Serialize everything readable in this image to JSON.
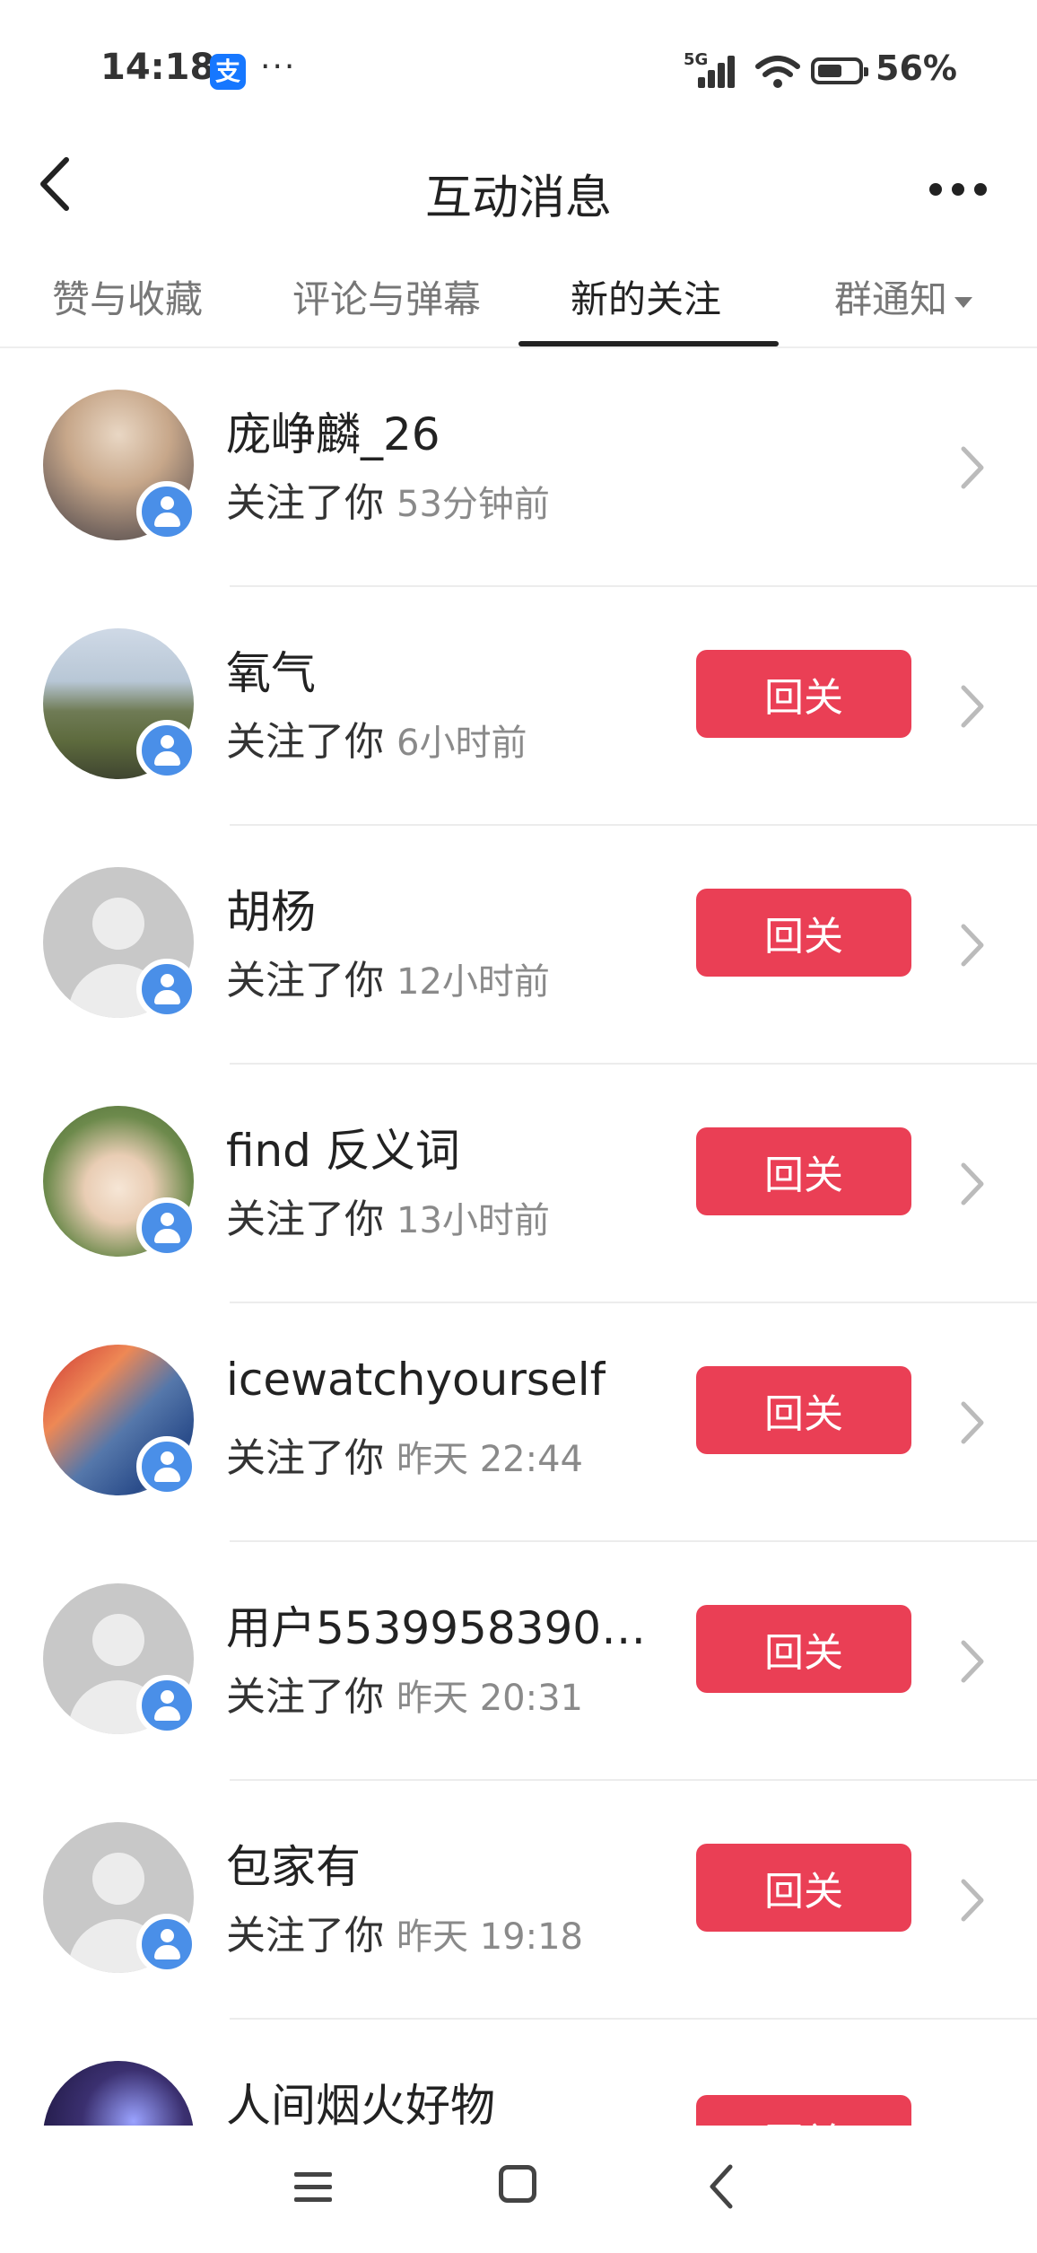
{
  "status_bar": {
    "time": "14:18",
    "app_icon_char": "支",
    "more_dots": "···",
    "network": "5G",
    "battery_percent": "56%"
  },
  "header": {
    "title": "互动消息"
  },
  "tabs": [
    {
      "label": "赞与收藏",
      "active": false
    },
    {
      "label": "评论与弹幕",
      "active": false
    },
    {
      "label": "新的关注",
      "active": true
    },
    {
      "label": "群通知",
      "active": false,
      "has_dropdown": true
    }
  ],
  "follow_back_label": "回关",
  "followers": [
    {
      "name": "庞峥麟_26",
      "action": "关注了你",
      "time": "53分钟前",
      "avatar": "photo",
      "show_follow_back": false
    },
    {
      "name": "氧气",
      "action": "关注了你",
      "time": "6小时前",
      "avatar": "photo",
      "show_follow_back": true
    },
    {
      "name": "胡杨",
      "action": "关注了你",
      "time": "12小时前",
      "avatar": "default",
      "show_follow_back": true
    },
    {
      "name": "find 反义词",
      "action": "关注了你",
      "time": "13小时前",
      "avatar": "photo",
      "show_follow_back": true
    },
    {
      "name": "icewatchyourself",
      "action": "关注了你",
      "time": "昨天 22:44",
      "avatar": "photo",
      "show_follow_back": true
    },
    {
      "name": "用户5539958390…",
      "action": "关注了你",
      "time": "昨天 20:31",
      "avatar": "default",
      "show_follow_back": true
    },
    {
      "name": "包家有",
      "action": "关注了你",
      "time": "昨天 19:18",
      "avatar": "default",
      "show_follow_back": true
    },
    {
      "name": "人间烟火好物",
      "action": "",
      "time": "",
      "avatar": "photo",
      "show_follow_back": true
    }
  ],
  "colors": {
    "accent": "#ea3f55",
    "badge": "#4a8fe8"
  },
  "icons": {
    "back": "chevron-left-icon",
    "more": "more-dots-icon",
    "row_arrow": "chevron-right-icon",
    "nav": [
      "menu-icon",
      "home-icon",
      "back-icon"
    ]
  }
}
